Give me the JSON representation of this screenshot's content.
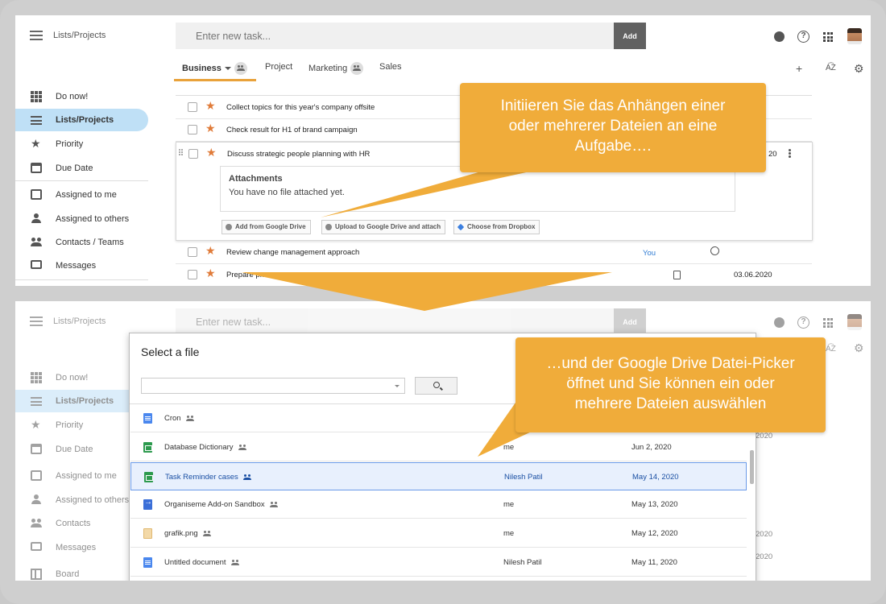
{
  "header": {
    "breadcrumb": "Lists/Projects",
    "task_placeholder": "Enter new task...",
    "add_label": "Add"
  },
  "tabs": [
    {
      "label": "Business"
    },
    {
      "label": "Project"
    },
    {
      "label": "Marketing"
    },
    {
      "label": "Sales"
    }
  ],
  "sidebar": {
    "items": [
      {
        "label": "Do now!"
      },
      {
        "label": "Lists/Projects"
      },
      {
        "label": "Priority"
      },
      {
        "label": "Due Date"
      },
      {
        "label": "Assigned to me"
      },
      {
        "label": "Assigned to others"
      },
      {
        "label": "Contacts / Teams"
      },
      {
        "label": "Messages"
      }
    ],
    "bottom_items": [
      {
        "label": "Do now!"
      },
      {
        "label": "Lists/Projects"
      },
      {
        "label": "Priority"
      },
      {
        "label": "Due Date"
      },
      {
        "label": "Assigned to me"
      },
      {
        "label": "Assigned to others"
      },
      {
        "label": "Contacts"
      },
      {
        "label": "Messages"
      },
      {
        "label": "Board"
      }
    ]
  },
  "tasks": [
    {
      "title": "Collect topics for this year's company offsite"
    },
    {
      "title": "Check result for H1 of brand campaign"
    },
    {
      "title": "Discuss strategic people planning with HR",
      "date_fragment": "20"
    },
    {
      "title": "Review change management approach",
      "assignee": "You"
    },
    {
      "title": "Prepare pr...",
      "date": "03.06.2020"
    }
  ],
  "attachments": {
    "title": "Attachments",
    "empty": "You have no file attached yet.",
    "buttons": [
      "Add from Google Drive",
      "Upload to Google Drive and attach",
      "Choose from Dropbox"
    ]
  },
  "picker": {
    "title": "Select a file",
    "files": [
      {
        "name": "Cron",
        "owner": "",
        "date": "",
        "type": "doc"
      },
      {
        "name": "Database Dictionary",
        "owner": "me",
        "date": "Jun 2, 2020",
        "type": "sheet"
      },
      {
        "name": "Task Reminder cases",
        "owner": "Nilesh Patil",
        "date": "May 14, 2020",
        "type": "sheet",
        "selected": true
      },
      {
        "name": "Organiseme Add-on Sandbox",
        "owner": "me",
        "date": "May 13, 2020",
        "type": "link"
      },
      {
        "name": "grafik.png",
        "owner": "me",
        "date": "May 12, 2020",
        "type": "img"
      },
      {
        "name": "Untitled document",
        "owner": "Nilesh Patil",
        "date": "May 11, 2020",
        "type": "doc"
      }
    ],
    "bg_dates": [
      "2020",
      "2020",
      "2020"
    ]
  },
  "callouts": {
    "first": [
      "Initiieren Sie das Anhängen einer",
      "oder mehrerer Dateien an eine",
      "Aufgabe…."
    ],
    "second": [
      "…und der Google Drive Datei-Picker",
      "öffnet und Sie können ein oder",
      "mehrere Dateien auswählen"
    ]
  },
  "colors": {
    "accent": "#e9a23b",
    "callout": "#f0ac3a",
    "star": "#e07b39",
    "selected_row": "#e8f0fd"
  }
}
